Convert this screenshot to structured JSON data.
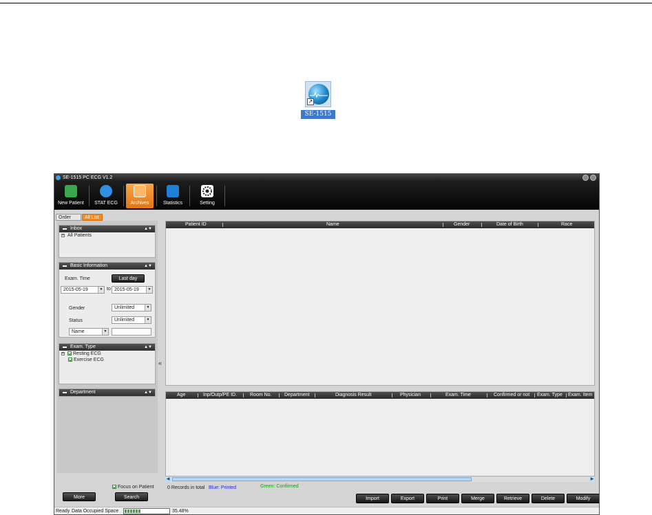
{
  "desktop_icon": {
    "label": "SE-1515"
  },
  "window": {
    "title": "SE-1515 PC ECG V1.2"
  },
  "toolbar": [
    {
      "label": "New Patient",
      "icon": "new-patient-icon",
      "color": "#3aa84a"
    },
    {
      "label": "STAT ECG",
      "icon": "stat-ecg-icon",
      "color": "#2f8fe0"
    },
    {
      "label": "Archives",
      "icon": "archives-icon",
      "color": "#f08a24",
      "active": true
    },
    {
      "label": "Statistics",
      "icon": "statistics-icon",
      "color": "#1e7fd6"
    },
    {
      "label": "Setting",
      "icon": "gear-icon",
      "color": "#ffffff"
    }
  ],
  "tabs": {
    "order_list": "Order List",
    "all_list": "All List"
  },
  "inbox": {
    "title": "Inbox",
    "items": [
      "All Patients"
    ]
  },
  "basic_info": {
    "title": "Basic Information",
    "exam_time_label": "Exam. Time",
    "last_day_button": "Last day",
    "date_from": "2015-05-19",
    "to_label": "to",
    "date_to": "2015-05-19",
    "gender_label": "Gender",
    "gender_value": "Unlimited",
    "status_label": "Status",
    "status_value": "Unlimited",
    "search_field_value": "Name",
    "search_text": ""
  },
  "exam_type": {
    "title": "Exam. Type",
    "items": [
      "Resting ECG",
      "Exercise ECG"
    ]
  },
  "department": {
    "title": "Department"
  },
  "patient_table": {
    "columns": [
      "Patient ID",
      "Name",
      "Gender",
      "Date of Birth",
      "Race"
    ]
  },
  "exam_table": {
    "columns": [
      "Age",
      "Inp/Outp/PE ID.",
      "Room No.",
      "Department",
      "Diagnosis Result",
      "Physician",
      "Exam. Time",
      "Confirmed or not",
      "Exam. Type",
      "Exam. Item"
    ]
  },
  "focus_on_patient": "Focus on Patient",
  "left_buttons": {
    "more": "More",
    "search": "Search"
  },
  "records_total": "0 Records in total",
  "legend": {
    "blue": "Blue: Printed",
    "green": "Green: Confirmed",
    "blue_color": "#2a2acc",
    "green_color": "#1a9a1a"
  },
  "actions": [
    "Import",
    "Export",
    "Print",
    "Merge",
    "Retrieve",
    "Delete",
    "Modify"
  ],
  "statusbar": {
    "ready": "Ready",
    "occupied_label": "Data Occupied Space",
    "occupied_percent": "35.48%",
    "occupied_fraction": 0.3548
  }
}
